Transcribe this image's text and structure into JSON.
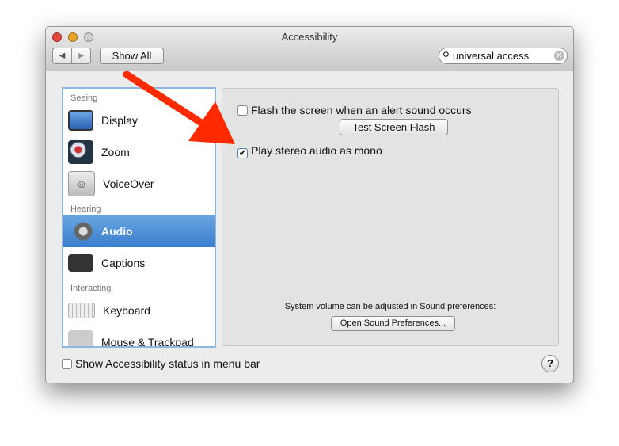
{
  "window": {
    "title": "Accessibility"
  },
  "toolbar": {
    "back": "◀",
    "forward": "▶",
    "show_all": "Show All",
    "search_value": "universal access"
  },
  "sidebar": {
    "sections": [
      {
        "label": "Seeing"
      },
      {
        "label": "Hearing"
      },
      {
        "label": "Interacting"
      }
    ],
    "items": [
      {
        "label": "Display"
      },
      {
        "label": "Zoom"
      },
      {
        "label": "VoiceOver"
      },
      {
        "label": "Audio",
        "selected": true
      },
      {
        "label": "Captions"
      },
      {
        "label": "Keyboard"
      },
      {
        "label": "Mouse & Trackpad"
      }
    ]
  },
  "audio": {
    "flash_label": "Flash the screen when an alert sound occurs",
    "flash_checked": false,
    "test_flash": "Test Screen Flash",
    "mono_label": "Play stereo audio as mono",
    "mono_checked": true,
    "volume_note": "System volume can be adjusted in Sound preferences:",
    "open_sound": "Open Sound Preferences..."
  },
  "footer": {
    "status_label": "Show Accessibility status in menu bar",
    "status_checked": false,
    "help": "?"
  },
  "colors": {
    "selection": "#3a7ecf",
    "arrow": "#ff2a00"
  }
}
